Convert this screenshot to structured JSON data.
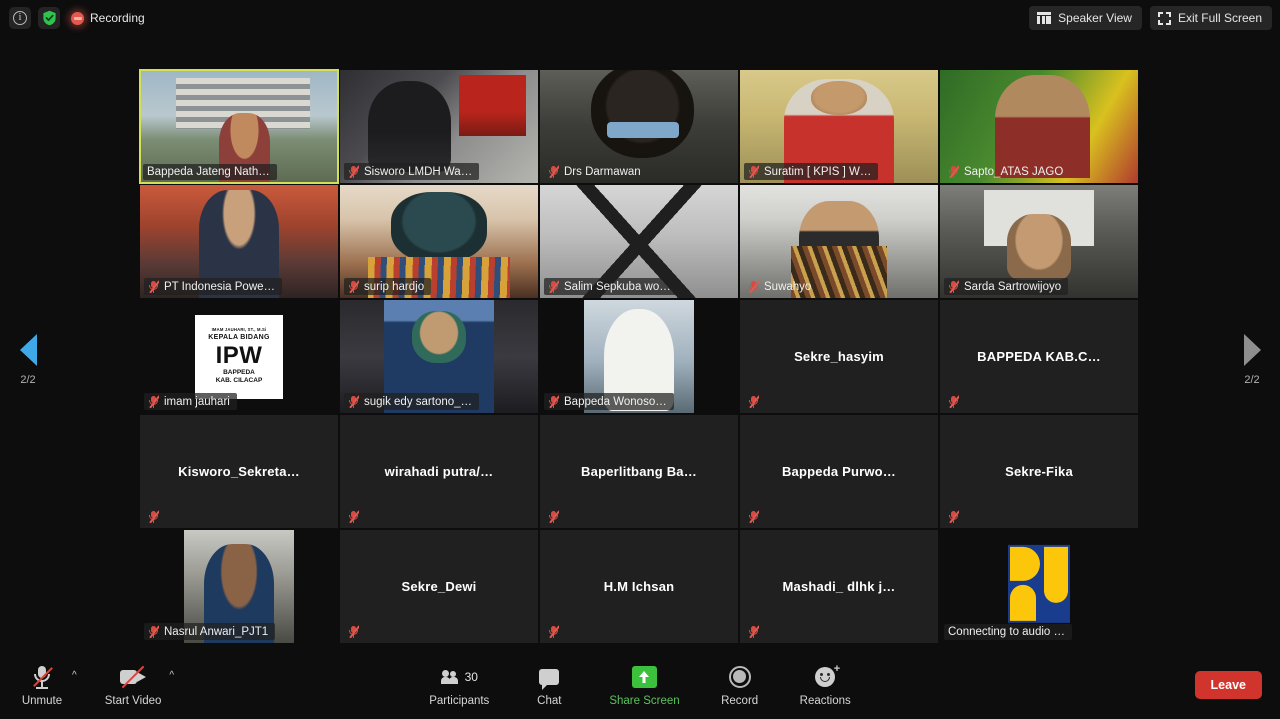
{
  "topbar": {
    "info_icon": "info-icon",
    "shield_icon": "shield-encryption-icon",
    "recording_label": "Recording",
    "speaker_view_label": "Speaker View",
    "exit_full_screen_label": "Exit Full Screen"
  },
  "pager": {
    "prev_label": "2/2",
    "next_label": "2/2"
  },
  "gallery": {
    "tiles": [
      {
        "name": "Bappeda Jateng Nath…",
        "muted": false,
        "active": true,
        "kind": "video",
        "video": "v-bappeda"
      },
      {
        "name": "Sisworo LMDH Wa…",
        "muted": true,
        "active": false,
        "kind": "video",
        "video": "v-sisworo"
      },
      {
        "name": "Drs Darmawan",
        "muted": true,
        "active": false,
        "kind": "video",
        "video": "v-darmawan",
        "bare": true
      },
      {
        "name": "Suratim [ KPIS ] W…",
        "muted": true,
        "active": false,
        "kind": "video",
        "video": "v-suratim"
      },
      {
        "name": "Sapto_ATAS JAGO",
        "muted": true,
        "active": false,
        "kind": "video",
        "video": "v-sapto",
        "bare": true
      },
      {
        "name": "PT Indonesia Powe…",
        "muted": true,
        "active": false,
        "kind": "video",
        "video": "v-ip"
      },
      {
        "name": "surip hardjo",
        "muted": true,
        "active": false,
        "kind": "video",
        "video": "v-surip"
      },
      {
        "name": "Salim Sepkuba wo…",
        "muted": true,
        "active": false,
        "kind": "video",
        "video": "v-salim"
      },
      {
        "name": "Suwahyo",
        "muted": true,
        "active": false,
        "kind": "video",
        "video": "v-suwahyo",
        "bare": true
      },
      {
        "name": "Sarda Sartrowijoyo",
        "muted": true,
        "active": false,
        "kind": "video",
        "video": "v-sarda"
      },
      {
        "name": "imam jauhari",
        "muted": true,
        "active": false,
        "kind": "slide",
        "video": "v-ipw"
      },
      {
        "name": "sugik edy sartono_…",
        "muted": true,
        "active": false,
        "kind": "video",
        "video": "v-sugik"
      },
      {
        "name": "Bappeda Wonoso…",
        "muted": true,
        "active": false,
        "kind": "video",
        "video": "v-wonoso"
      },
      {
        "name": "Sekre_hasyim",
        "muted": true,
        "active": false,
        "kind": "text"
      },
      {
        "name": "BAPPEDA KAB.C…",
        "muted": true,
        "active": false,
        "kind": "text"
      },
      {
        "name": "Kisworo_Sekreta…",
        "muted": true,
        "active": false,
        "kind": "text"
      },
      {
        "name": "wirahadi  putra/…",
        "muted": true,
        "active": false,
        "kind": "text"
      },
      {
        "name": "Baperlitbang  Ba…",
        "muted": true,
        "active": false,
        "kind": "text"
      },
      {
        "name": "Bappeda  Purwo…",
        "muted": true,
        "active": false,
        "kind": "text"
      },
      {
        "name": "Sekre-Fika",
        "muted": true,
        "active": false,
        "kind": "text"
      },
      {
        "name": "Nasrul Anwari_PJT1",
        "muted": true,
        "active": false,
        "kind": "video",
        "video": "v-nasrul"
      },
      {
        "name": "Sekre_Dewi",
        "muted": true,
        "active": false,
        "kind": "text"
      },
      {
        "name": "H.M Ichsan",
        "muted": true,
        "active": false,
        "kind": "text"
      },
      {
        "name": "Mashadi_ dlhk j…",
        "muted": true,
        "active": false,
        "kind": "text"
      },
      {
        "name": "Connecting to audio …",
        "muted": false,
        "active": false,
        "kind": "logo",
        "video": "v-pu"
      }
    ],
    "ipw_slide": {
      "line1": "IMAM JAUHARI, ST., M.Si",
      "line2": "KEPALA BIDANG",
      "line3": "IPW",
      "line4": "BAPPEDA",
      "line5": "KAB. CILACAP"
    }
  },
  "toolbar": {
    "unmute_label": "Unmute",
    "start_video_label": "Start Video",
    "participants_label": "Participants",
    "participants_count": "30",
    "chat_label": "Chat",
    "share_screen_label": "Share Screen",
    "record_label": "Record",
    "reactions_label": "Reactions",
    "leave_label": "Leave"
  },
  "colors": {
    "app_bg": "#0d0d0d",
    "tile_bg": "#202020",
    "active_border": "#d4e157",
    "accent_green": "#3cc13c",
    "leave_red": "#d0342c",
    "prev_arrow": "#3fa9e8",
    "next_arrow": "#8e8e8e"
  }
}
